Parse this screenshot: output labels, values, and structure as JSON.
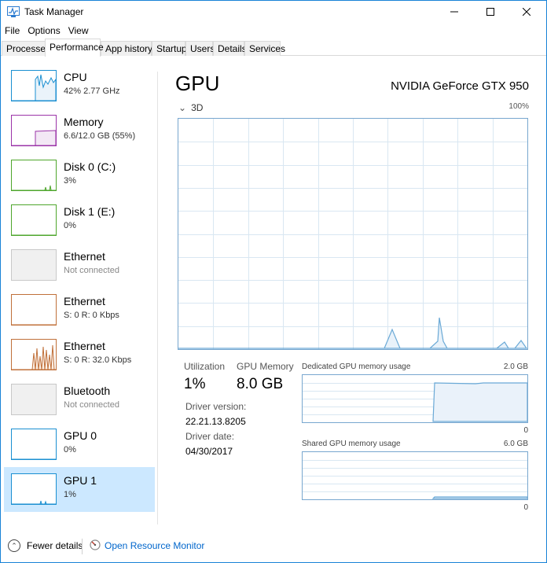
{
  "window": {
    "title": "Task Manager"
  },
  "menu": {
    "items": [
      "File",
      "Options",
      "View"
    ]
  },
  "tabs": [
    "Processes",
    "Performance",
    "App history",
    "Startup",
    "Users",
    "Details",
    "Services"
  ],
  "active_tab": "Performance",
  "sidebar": {
    "items": [
      {
        "name": "CPU",
        "sub": "42%  2.77 GHz",
        "color": "#1a8fd1",
        "fill": "#eaf3fa"
      },
      {
        "name": "Memory",
        "sub": "6.6/12.0 GB (55%)",
        "color": "#9b34a8",
        "fill": "#f3e8f5"
      },
      {
        "name": "Disk 0 (C:)",
        "sub": "3%",
        "color": "#4ea62c",
        "fill": "#eef7ea"
      },
      {
        "name": "Disk 1 (E:)",
        "sub": "0%",
        "color": "#4ea62c",
        "fill": "#eef7ea"
      },
      {
        "name": "Ethernet",
        "sub": "Not connected",
        "color": "#c8c8c8",
        "fill": "#f0f0f0"
      },
      {
        "name": "Ethernet",
        "sub": "S: 0  R: 0 Kbps",
        "color": "#c0703a",
        "fill": "#fbefe5"
      },
      {
        "name": "Ethernet",
        "sub": "S: 0  R: 32.0 Kbps",
        "color": "#c0703a",
        "fill": "#fbefe5"
      },
      {
        "name": "Bluetooth",
        "sub": "Not connected",
        "color": "#c8c8c8",
        "fill": "#f0f0f0"
      },
      {
        "name": "GPU 0",
        "sub": "0%",
        "color": "#1a8fd1",
        "fill": "#eaf3fa"
      },
      {
        "name": "GPU 1",
        "sub": "1%",
        "color": "#1a8fd1",
        "fill": "#eaf3fa"
      }
    ],
    "selected_index": 9
  },
  "main": {
    "title": "GPU",
    "model": "NVIDIA GeForce GTX 950",
    "engine": "3D",
    "engine_max": "100%",
    "graph_color": "#6aa9d6",
    "graph_fill": "#e9f2fa",
    "stats": {
      "utilization_label": "Utilization",
      "utilization_value": "1%",
      "gpu_memory_label": "GPU Memory",
      "gpu_memory_value": "8.0 GB",
      "driver_version_label": "Driver version:",
      "driver_version_value": "22.21.13.8205",
      "driver_date_label": "Driver date:",
      "driver_date_value": "04/30/2017"
    },
    "dedicated": {
      "label": "Dedicated GPU memory usage",
      "max": "2.0 GB",
      "min": "0"
    },
    "shared": {
      "label": "Shared GPU memory usage",
      "max": "6.0 GB",
      "min": "0"
    }
  },
  "footer": {
    "fewer_details": "Fewer details",
    "resource_monitor": "Open Resource Monitor"
  }
}
